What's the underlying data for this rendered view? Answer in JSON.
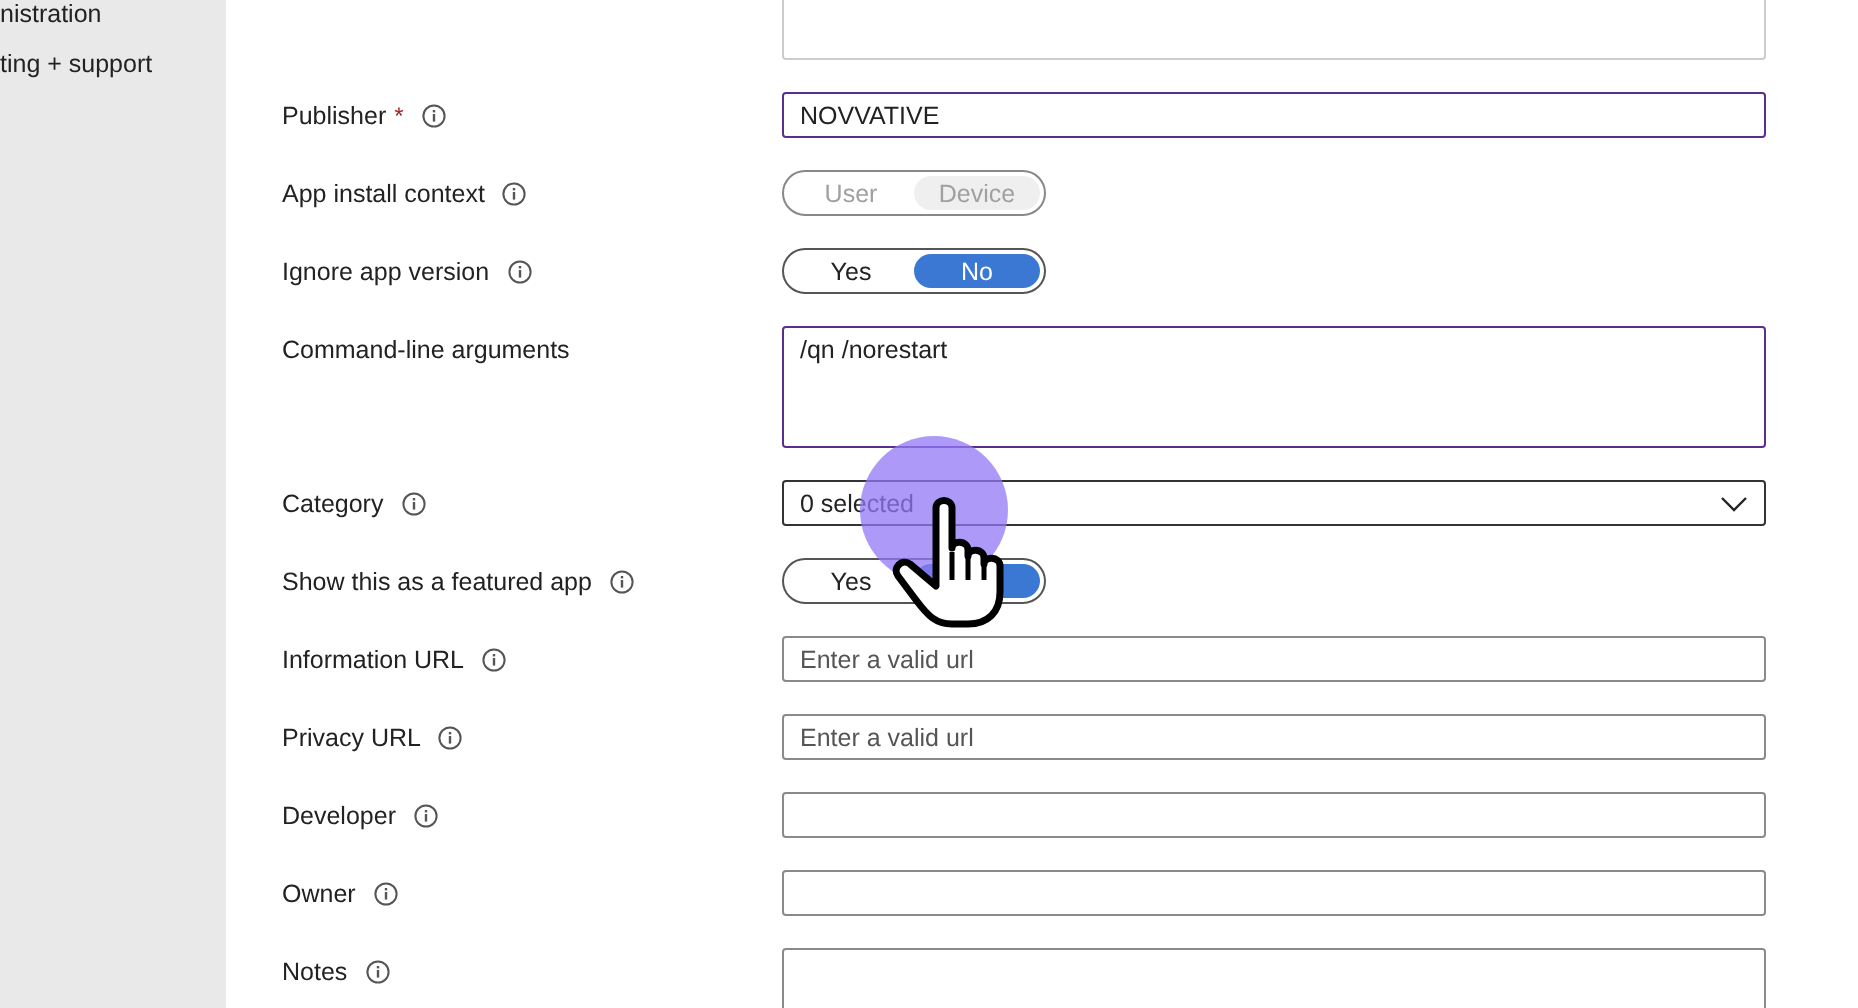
{
  "sidebar": {
    "items": [
      {
        "label": "nistration"
      },
      {
        "label": "ting + support"
      }
    ]
  },
  "form": {
    "fields": [
      {
        "kind": "textarea",
        "disabled": true,
        "highlighted": false
      },
      {
        "kind": "text",
        "label": "Publisher",
        "required_mark": "*",
        "info": true,
        "value": "NOVVATIVE",
        "highlighted": true
      },
      {
        "kind": "toggle",
        "label": "App install context",
        "info": true,
        "disabled": true,
        "options": [
          {
            "label": "User",
            "selected": false
          },
          {
            "label": "Device",
            "selected": true
          }
        ]
      },
      {
        "kind": "toggle",
        "label": "Ignore app version",
        "info": true,
        "disabled": false,
        "options": [
          {
            "label": "Yes",
            "selected": false
          },
          {
            "label": "No",
            "selected": true
          }
        ]
      },
      {
        "kind": "textarea",
        "label": "Command-line arguments",
        "info": false,
        "value": "/qn /norestart",
        "highlighted": true,
        "disabled": false
      },
      {
        "kind": "dropdown",
        "label": "Category",
        "info": true,
        "value": "0 selected"
      },
      {
        "kind": "toggle",
        "label": "Show this as a featured app",
        "info": true,
        "disabled": false,
        "options": [
          {
            "label": "Yes",
            "selected": false
          },
          {
            "selected": true
          }
        ]
      },
      {
        "kind": "text",
        "label": "Information URL",
        "info": true,
        "placeholder": "Enter a valid url",
        "highlighted": false
      },
      {
        "kind": "text",
        "label": "Privacy URL",
        "info": true,
        "placeholder": "Enter a valid url",
        "highlighted": false
      },
      {
        "kind": "text",
        "label": "Developer",
        "info": true,
        "highlighted": false
      },
      {
        "kind": "text",
        "label": "Owner",
        "info": true,
        "highlighted": false
      },
      {
        "kind": "textarea",
        "label": "Notes",
        "info": true,
        "highlighted": false,
        "disabled": false
      }
    ]
  }
}
